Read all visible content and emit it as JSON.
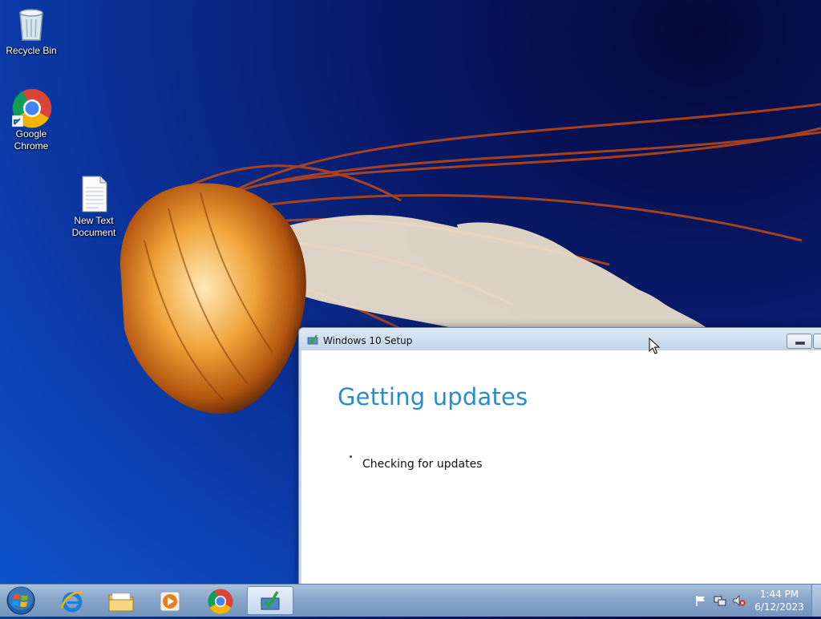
{
  "desktop": {
    "icons": [
      {
        "label": "Recycle Bin",
        "icon": "recycle-bin-icon"
      },
      {
        "label": "Google\nChrome",
        "icon": "chrome-icon"
      },
      {
        "label": "New Text\nDocument",
        "icon": "text-document-icon"
      }
    ]
  },
  "setup_window": {
    "title": "Windows 10 Setup",
    "heading": "Getting updates",
    "status": "Checking for updates"
  },
  "taskbar": {
    "pinned": [
      {
        "name": "internet-explorer",
        "icon": "ie-icon"
      },
      {
        "name": "file-explorer",
        "icon": "folder-icon"
      },
      {
        "name": "media-player",
        "icon": "media-player-icon"
      },
      {
        "name": "chrome",
        "icon": "chrome-icon"
      },
      {
        "name": "windows-10-setup",
        "icon": "setup-icon",
        "active": true
      }
    ],
    "tray": {
      "icons": [
        "action-center-flag-icon",
        "network-icon",
        "volume-muted-icon"
      ],
      "time": "1:44 PM",
      "date": "6/12/2023"
    }
  },
  "colors": {
    "heading": "#2a8bc9",
    "wallpaper_deep": "#05093a",
    "wallpaper_light": "#0f55cf"
  }
}
